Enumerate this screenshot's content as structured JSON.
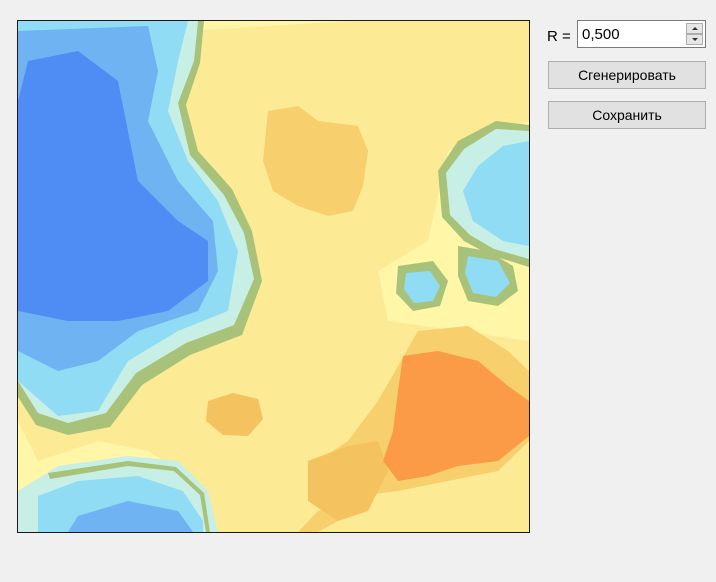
{
  "controls": {
    "r_label": "R =",
    "r_value": "0,500",
    "generate_label": "Сгенерировать",
    "save_label": "Сохранить"
  },
  "map": {
    "palette": {
      "deep_water": "#4f8df5",
      "water": "#6fb3f2",
      "shallow_water": "#8fdcf4",
      "coast": "#c8efe6",
      "shore": "#a8c27a",
      "lowland": "#fff6a8",
      "plain": "#fdea94",
      "hill": "#f7cf6c",
      "highland": "#f5c260",
      "peak": "#fb9b47"
    }
  }
}
